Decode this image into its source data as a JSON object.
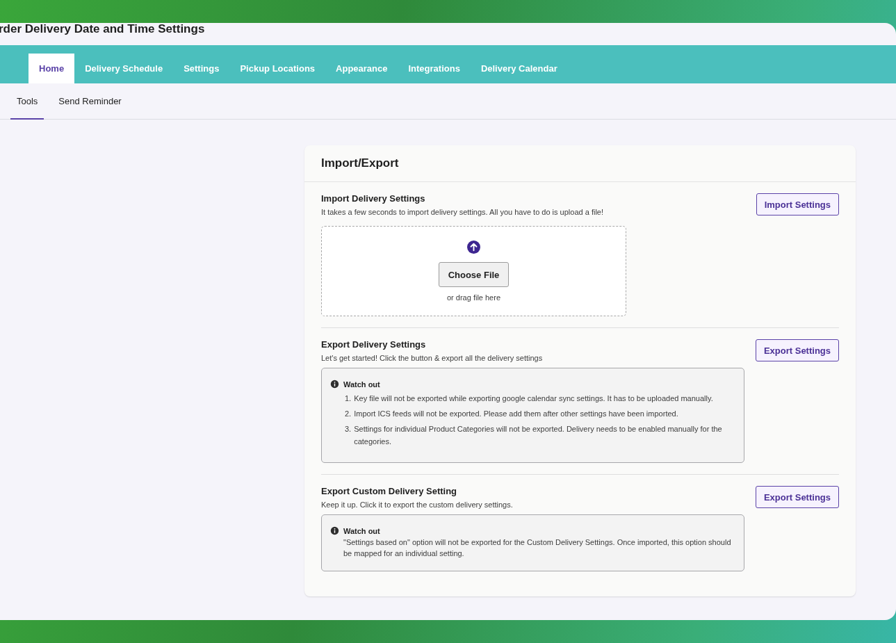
{
  "window": {
    "title": "rder Delivery Date and Time Settings"
  },
  "tabs": [
    {
      "label": "Home",
      "selected": true
    },
    {
      "label": "Delivery Schedule",
      "selected": false
    },
    {
      "label": "Settings",
      "selected": false
    },
    {
      "label": "Pickup Locations",
      "selected": false
    },
    {
      "label": "Appearance",
      "selected": false
    },
    {
      "label": "Integrations",
      "selected": false
    },
    {
      "label": "Delivery Calendar",
      "selected": false
    }
  ],
  "subtabs": [
    {
      "label": "Tools",
      "selected": true
    },
    {
      "label": "Send Reminder",
      "selected": false
    }
  ],
  "card": {
    "title": "Import/Export",
    "sections": [
      {
        "kind": "import",
        "title": "Import Delivery Settings",
        "description": "It takes a few seconds to import delivery settings. All you have to do is upload a file!",
        "button": "Import Settings",
        "dropzone": {
          "button": "Choose File",
          "hint": "or drag file here"
        }
      },
      {
        "kind": "export",
        "title": "Export Delivery Settings",
        "description": "Let's get started! Click the button & export all the delivery settings",
        "button": "Export Settings",
        "notice": {
          "title": "Watch out",
          "items": [
            {
              "number": "1.",
              "text": "Key file will not be exported while exporting google calendar sync settings. It has to be uploaded manually."
            },
            {
              "number": "2.",
              "text": "Import ICS feeds will not be exported. Please add them after other settings have been imported."
            },
            {
              "number": "3.",
              "text": "Settings for individual Product Categories will not be exported. Delivery needs to be enabled manually for the categories."
            }
          ]
        }
      },
      {
        "kind": "export",
        "title": "Export Custom Delivery Setting",
        "description": "Keep it up. Click it to export the custom delivery settings.",
        "button": "Export Settings",
        "notice": {
          "title": "Watch out",
          "text": "\"Settings based on\" option will not be exported for the Custom Delivery Settings. Once imported, this option should be mapped for an individual setting."
        }
      }
    ]
  }
}
